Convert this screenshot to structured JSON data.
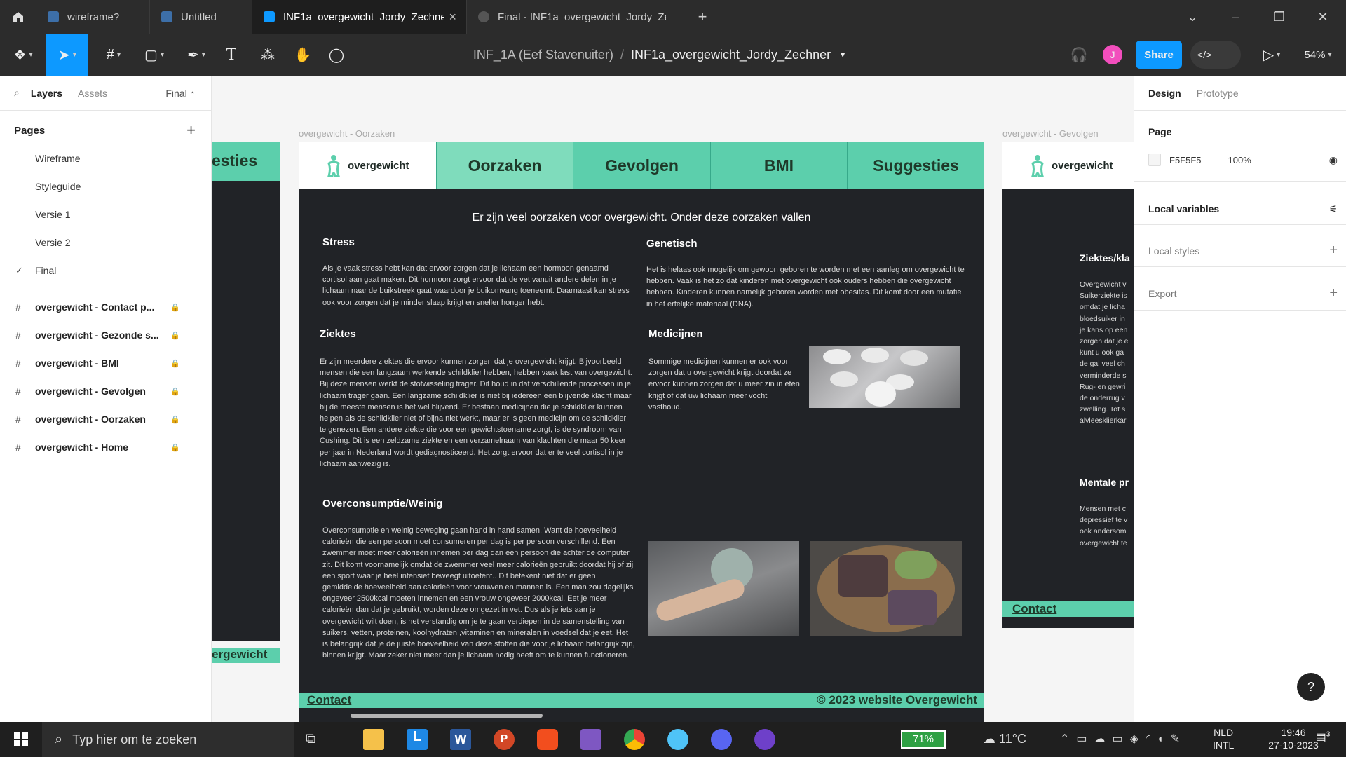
{
  "tabs": [
    {
      "label": "wireframe?",
      "active": false,
      "icon": "figma-file-icon"
    },
    {
      "label": "Untitled",
      "active": false,
      "icon": "figma-file-icon"
    },
    {
      "label": "INF1a_overgewicht_Jordy_Zechner",
      "active": true,
      "icon": "figma-file-icon"
    },
    {
      "label": "Final - INF1a_overgewicht_Jordy_Zechner",
      "active": false,
      "icon": "play-icon"
    }
  ],
  "breadcrumb": {
    "team": "INF_1A (Eef Stavenuiter)",
    "sep": "/",
    "file": "INF1a_overgewicht_Jordy_Zechner"
  },
  "toolbar": {
    "avatar": "J",
    "share": "Share",
    "code": "</>",
    "zoom": "54%"
  },
  "left": {
    "tab_layers": "Layers",
    "tab_assets": "Assets",
    "page_select": "Final",
    "pages_title": "Pages",
    "pages": [
      "Wireframe",
      "Styleguide",
      "Versie 1",
      "Versie 2",
      "Final"
    ],
    "frames": [
      "overgewicht - Contact p...",
      "overgewicht - Gezonde s...",
      "overgewicht - BMI",
      "overgewicht - Gevolgen",
      "overgewicht - Oorzaken",
      "overgewicht - Home"
    ]
  },
  "right": {
    "tab_design": "Design",
    "tab_prototype": "Prototype",
    "page_label": "Page",
    "page_color": "F5F5F5",
    "page_opacity": "100%",
    "local_variables": "Local variables",
    "local_styles": "Local styles",
    "export": "Export"
  },
  "canvas": {
    "frame_title_main": "overgewicht - Oorzaken",
    "frame_title_right": "overgewicht - Gevolgen",
    "logo_text": "overgewicht",
    "nav": [
      "Oorzaken",
      "Gevolgen",
      "BMI",
      "Suggesties"
    ],
    "left_frame_nav": "esties",
    "left_frame_footer": "ergewicht",
    "intro": "Er zijn veel oorzaken voor overgewicht. Onder deze oorzaken vallen",
    "sections": {
      "stress": {
        "title": "Stress",
        "body": "Als je vaak stress hebt kan dat ervoor zorgen dat je lichaam een hormoon genaamd cortisol aan gaat maken. Dit hormoon zorgt ervoor dat de vet vanuit andere delen in je lichaam naar de buikstreek gaat waardoor je buikomvang toeneemt. Daarnaast kan stress ook voor zorgen dat je minder slaap krijgt en sneller honger hebt."
      },
      "genetisch": {
        "title": "Genetisch",
        "body": "Het is helaas ook mogelijk om gewoon geboren te worden met een aanleg om overgewicht te hebben. Vaak is het zo dat kinderen met overgewicht ook ouders hebben die overgewicht hebben. Kinderen kunnen namelijk geboren worden met obesitas. Dit komt door een mutatie in het erfelijke materiaal (DNA)."
      },
      "ziektes": {
        "title": "Ziektes",
        "body": "Er zijn meerdere ziektes die ervoor kunnen zorgen dat je overgewicht krijgt. Bijvoorbeeld mensen die een langzaam werkende schildklier hebben, hebben vaak last van overgewicht. Bij deze mensen werkt de stofwisseling trager. Dit houd in dat verschillende processen in je lichaam trager gaan. Een langzame schildklier is niet bij iedereen een blijvende klacht maar bij de meeste mensen is het wel blijvend. Er bestaan medicijnen die je schildklier kunnen helpen als de schildklier niet of bijna niet werkt, maar er is geen medicijn om de schildklier te genezen. Een andere ziekte die voor een gewichtstoename zorgt, is de syndroom van Cushing. Dit is een zeldzame ziekte en een verzamelnaam van klachten die maar 50 keer per jaar in Nederland wordt gediagnosticeerd. Het zorgt ervoor dat er te veel cortisol in je lichaam aanwezig is."
      },
      "medicijnen": {
        "title": "Medicijnen",
        "body": "Sommige medicijnen kunnen er ook voor zorgen dat u overgewicht krijgt doordat ze ervoor kunnen zorgen dat u meer zin in eten krijgt of dat uw lichaam meer vocht vasthoud."
      },
      "overconsumptie": {
        "title": "Overconsumptie/Weinig",
        "body": "Overconsumptie en weinig beweging gaan hand in hand samen. Want de hoeveelheid calorieën die een persoon moet consumeren per dag is per persoon verschillend. Een zwemmer moet meer calorieën innemen per dag dan een persoon die achter de computer zit. Dit komt voornamelijk omdat de zwemmer veel meer calorieën gebruikt doordat hij of zij een sport waar je heel intensief beweegt uitoefent.. Dit betekent niet dat er geen gemiddelde hoeveelheid aan calorieën voor vrouwen en mannen is. Een man zou dagelijks ongeveer 2500kcal moeten innemen en een vrouw ongeveer 2000kcal. Eet je meer calorieën dan dat je gebruikt, worden deze omgezet in vet. Dus als je iets aan je overgewicht wilt doen, is het verstandig om je te gaan verdiepen in de samenstelling van suikers, vetten, proteinen, koolhydraten ,vitaminen en mineralen in voedsel dat je eet. Het is belangrijk dat je de juiste hoeveelheid van deze stoffen die voor je lichaam belangrijk zijn, binnen krijgt. Maar zeker niet meer dan je lichaam nodig heeft om te kunnen functioneren."
      }
    },
    "footer_contact": "Contact",
    "footer_copy": "© 2023 website Overgewicht",
    "right_frame": {
      "h1": "Ziektes/kla",
      "body1": "Overgewicht v\nSuikerziekte is\nomdat je licha\nbloedsuiker in\nje kans op een\nzorgen dat je e\nkunt u ook ga\nde gal veel ch\nverminderde s\nRug- en gewri\nde onderrug v\nzwelling. Tot s\nalvleesklierkar",
      "h2": "Mentale pr",
      "body2": "Mensen met c\ndepressief te v\nook andersom\novergewicht te",
      "contact": "Contact"
    }
  },
  "taskbar": {
    "search_placeholder": "Typ hier om te zoeken",
    "battery": "71%",
    "temp": "11°C",
    "lang1": "NLD",
    "lang2": "INTL",
    "time": "19:46",
    "date": "27-10-2023",
    "notif": "3"
  },
  "colors": {
    "accent": "#5ccfac",
    "accent_active": "#7fdcbc",
    "figma_blue": "#0d99ff",
    "frame_bg": "#212327",
    "avatar": "#f24ebd"
  }
}
